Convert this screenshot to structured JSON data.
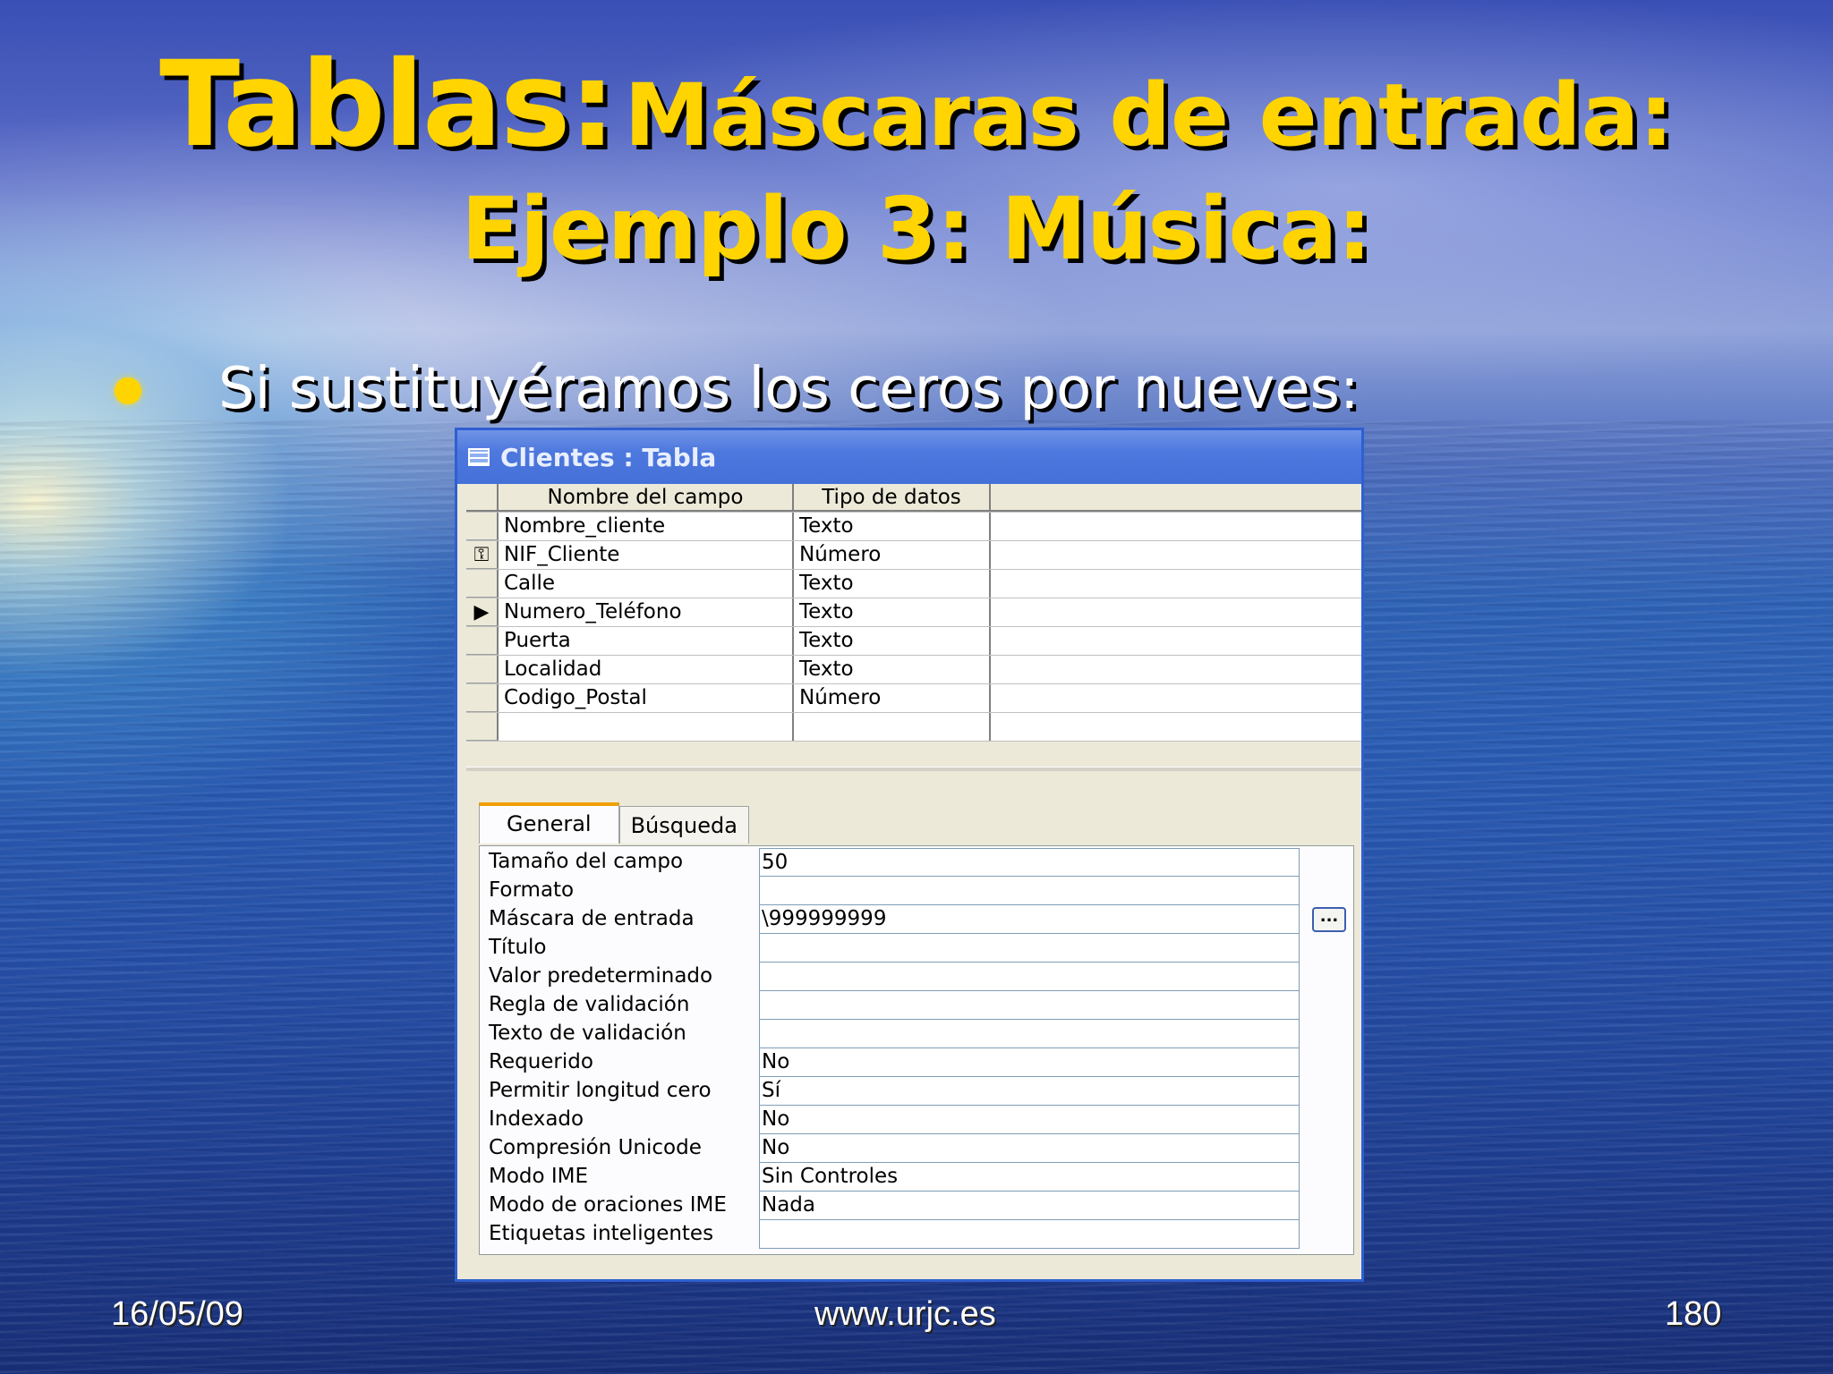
{
  "slide": {
    "title_line1_big": "Tablas:",
    "title_line1_rest": "Máscaras de entrada:",
    "title_line2": "Ejemplo 3: Música:",
    "bullet": "Si sustituyéramos los ceros por nueves:",
    "footer_date": "16/05/09",
    "footer_url": "www.urjc.es",
    "footer_page": "180"
  },
  "window": {
    "title": "Clientes : Tabla",
    "columns": [
      "Nombre del campo",
      "Tipo de datos"
    ],
    "rows": [
      {
        "field": "Nombre_cliente",
        "type": "Texto",
        "marker": ""
      },
      {
        "field": "NIF_Cliente",
        "type": "Número",
        "marker": "⚿"
      },
      {
        "field": "Calle",
        "type": "Texto",
        "marker": ""
      },
      {
        "field": "Numero_Teléfono",
        "type": "Texto",
        "marker": "▶"
      },
      {
        "field": "Puerta",
        "type": "Texto",
        "marker": ""
      },
      {
        "field": "Localidad",
        "type": "Texto",
        "marker": ""
      },
      {
        "field": "Codigo_Postal",
        "type": "Número",
        "marker": ""
      },
      {
        "field": "",
        "type": "",
        "marker": ""
      }
    ],
    "tabs": [
      "General",
      "Búsqueda"
    ],
    "build_button": "...",
    "properties": [
      {
        "label": "Tamaño del campo",
        "value": "50"
      },
      {
        "label": "Formato",
        "value": ""
      },
      {
        "label": "Máscara de entrada",
        "value": "\\999999999"
      },
      {
        "label": "Título",
        "value": ""
      },
      {
        "label": "Valor predeterminado",
        "value": ""
      },
      {
        "label": "Regla de validación",
        "value": ""
      },
      {
        "label": "Texto de validación",
        "value": ""
      },
      {
        "label": "Requerido",
        "value": "No"
      },
      {
        "label": "Permitir longitud cero",
        "value": "Sí"
      },
      {
        "label": "Indexado",
        "value": "No"
      },
      {
        "label": "Compresión Unicode",
        "value": "No"
      },
      {
        "label": "Modo IME",
        "value": "Sin Controles"
      },
      {
        "label": "Modo de oraciones IME",
        "value": "Nada"
      },
      {
        "label": "Etiquetas inteligentes",
        "value": ""
      }
    ]
  }
}
